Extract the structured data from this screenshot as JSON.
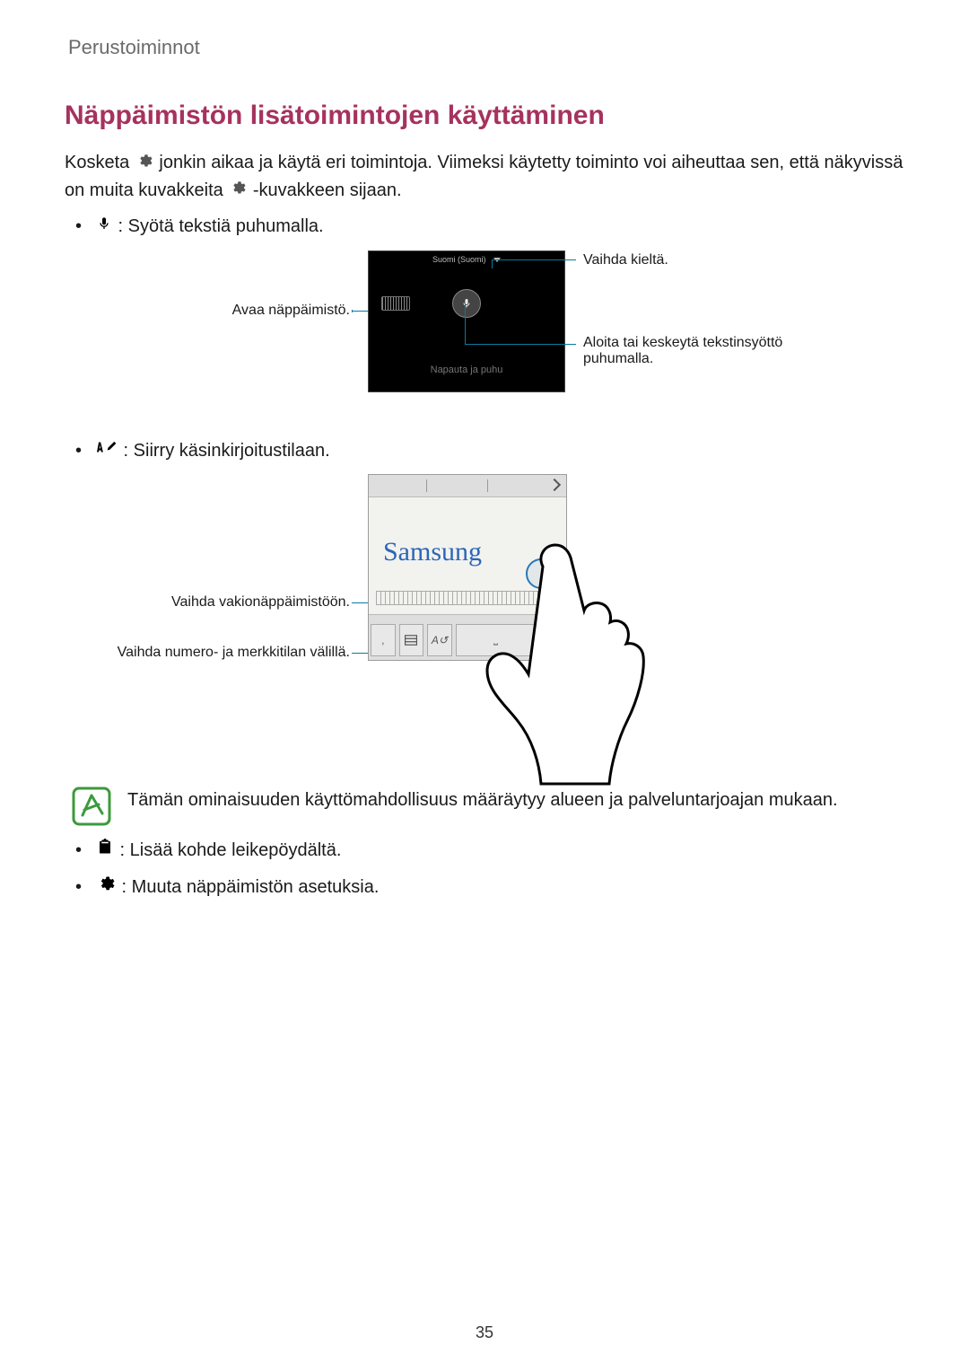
{
  "page_header": "Perustoiminnot",
  "section_title": "Näppäimistön lisätoimintojen käyttäminen",
  "intro": {
    "part1": "Kosketa ",
    "part2": " jonkin aikaa ja käytä eri toimintoja. Viimeksi käytetty toiminto voi aiheuttaa sen, että näkyvissä on muita kuvakkeita ",
    "part3": "-kuvakkeen sijaan."
  },
  "bullets": {
    "voice": " : Syötä tekstiä puhumalla.",
    "handwrite": " : Siirry käsinkirjoitustilaan.",
    "clipboard": " : Lisää kohde leikepöydältä.",
    "settings": " : Muuta näppäimistön asetuksia."
  },
  "voice_panel": {
    "top_label": "Suomi (Suomi)",
    "hint": "Napauta ja puhu"
  },
  "callouts": {
    "open_keyboard": "Avaa näppäimistö.",
    "change_language": "Vaihda kieltä.",
    "toggle_voice": "Aloita tai keskeytä tekstinsyöttö puhumalla.",
    "switch_std_keyboard": "Vaihda vakionäppäimistöön.",
    "toggle_num_sym": "Vaihda numero- ja merkkitilan välillä."
  },
  "handwriting": {
    "sample_text": "Samsung"
  },
  "note": "Tämän ominaisuuden käyttömahdollisuus määräytyy alueen ja palveluntarjoajan mukaan.",
  "page_number": "35"
}
